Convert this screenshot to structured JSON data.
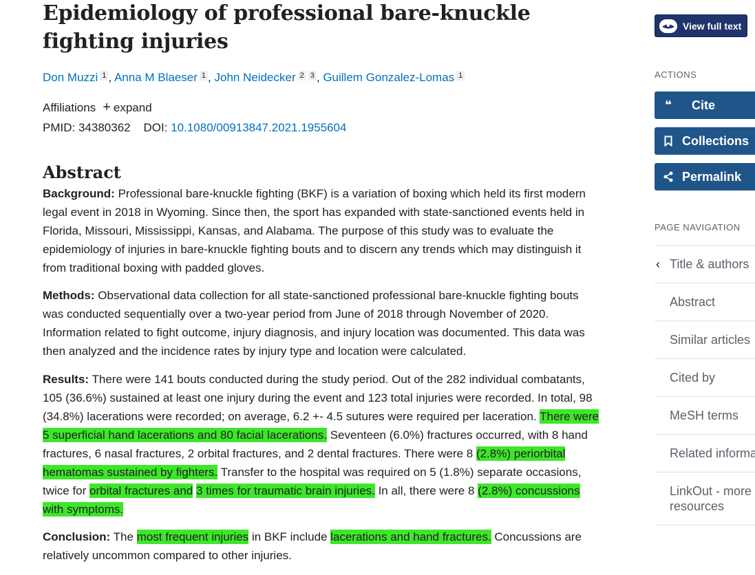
{
  "article": {
    "title": "Epidemiology of professional bare-knuckle fighting injuries",
    "authors": [
      {
        "name": "Don Muzzi",
        "aff": "1"
      },
      {
        "name": "Anna M Blaeser",
        "aff": "1"
      },
      {
        "name": "John Neidecker",
        "aff": "2",
        "aff2": "3"
      },
      {
        "name": "Guillem Gonzalez-Lomas",
        "aff": "1"
      }
    ],
    "affiliations_label": "Affiliations",
    "expand_label": "expand",
    "pmid_label": "PMID:",
    "pmid": "34380362",
    "doi_label": "DOI:",
    "doi": "10.1080/00913847.2021.1955604"
  },
  "abstract": {
    "heading": "Abstract",
    "background_label": "Background:",
    "background": "Professional bare-knuckle fighting (BKF) is a variation of boxing which held its first modern legal event in 2018 in Wyoming. Since then, the sport has expanded with state-sanctioned events held in Florida, Missouri, Mississippi, Kansas, and Alabama. The purpose of this study was to evaluate the epidemiology of injuries in bare-knuckle fighting bouts and to discern any trends which may distinguish it from traditional boxing with padded gloves.",
    "methods_label": "Methods:",
    "methods": "Observational data collection for all state-sanctioned professional bare-knuckle fighting bouts was conducted sequentially over a two-year period from June of 2018 through November of 2020. Information related to fight outcome, injury diagnosis, and injury location was documented. This data was then analyzed and the incidence rates by injury type and location were calculated.",
    "results_label": "Results:",
    "results_1": "There were 141 bouts conducted during the study period. Out of the 282 individual combatants, 105 (36.6%) sustained at least one injury during the event and 123 total injuries were recorded. In total, 98 (34.8%) lacerations were recorded; on average, 6.2 +- 4.5 sutures were required per laceration. ",
    "results_hl_1": "There were 5 superficial hand lacerations and 80 facial lacerations.",
    "results_2": " Seventeen (6.0%) fractures occurred, with 8 hand fractures, 6 nasal fractures, 2 orbital fractures, and 2 dental fractures. There were 8 ",
    "results_hl_2": "(2.8%) periorbital hematomas sustained by fighters.",
    "results_3": " Transfer to the hospital was required on 5 (1.8%) separate occasions, twice for ",
    "results_hl_3": "orbital fractures and",
    "results_4": " ",
    "results_hl_4": "3 times for traumatic brain injuries.",
    "results_5": " In all, there were 8 ",
    "results_hl_5": "(2.8%) concussions with symptoms.",
    "conclusion_label": "Conclusion:",
    "conclusion_1": " The ",
    "conclusion_hl_1": "most frequent injuries",
    "conclusion_2": " in BKF include ",
    "conclusion_hl_2": "lacerations and hand fractures.",
    "conclusion_3": " Concussions are relatively uncommon compared to other injuries."
  },
  "sidebar": {
    "full_text_label": "View full text",
    "actions_label": "ACTIONS",
    "cite_label": "Cite",
    "collections_label": "Collections",
    "permalink_label": "Permalink",
    "page_nav_label": "PAGE NAVIGATION",
    "nav_items": [
      "Title & authors",
      "Abstract",
      "Similar articles",
      "Cited by",
      "MeSH terms",
      "Related information",
      "LinkOut - more resources"
    ]
  },
  "colors": {
    "highlight": "#3ee62a",
    "link": "#0071bc",
    "button": "#20558a",
    "full_text_button": "#20336b"
  }
}
